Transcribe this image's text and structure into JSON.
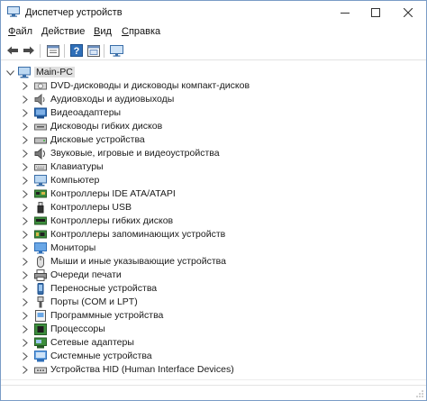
{
  "window": {
    "title": "Диспетчер устройств",
    "controls": [
      "minimize",
      "maximize",
      "close"
    ]
  },
  "menu": [
    {
      "label": "Файл",
      "accel": "Ф",
      "rest": "айл"
    },
    {
      "label": "Действие",
      "accel": "Д",
      "rest": "ействие"
    },
    {
      "label": "Вид",
      "accel": "В",
      "rest": "ид"
    },
    {
      "label": "Справка",
      "accel": "С",
      "rest": "правка"
    }
  ],
  "toolbar": {
    "buttons": [
      "back-icon",
      "forward-icon",
      "properties-icon",
      "help-icon",
      "view-icon",
      "monitor-icon"
    ]
  },
  "tree": {
    "root": {
      "label": "Main-PC",
      "icon": "computer-icon",
      "expanded": true
    },
    "items": [
      {
        "label": "DVD-дисководы и дисководы компакт-дисков",
        "icon": "dvd-drive-icon"
      },
      {
        "label": "Аудиовходы и аудиовыходы",
        "icon": "speaker-icon"
      },
      {
        "label": "Видеоадаптеры",
        "icon": "display-adapter-icon"
      },
      {
        "label": "Дисководы гибких дисков",
        "icon": "floppy-drive-icon"
      },
      {
        "label": "Дисковые устройства",
        "icon": "disk-drive-icon"
      },
      {
        "label": "Звуковые, игровые и видеоустройства",
        "icon": "sound-icon"
      },
      {
        "label": "Клавиатуры",
        "icon": "keyboard-icon"
      },
      {
        "label": "Компьютер",
        "icon": "computer-icon"
      },
      {
        "label": "Контроллеры IDE ATA/ATAPI",
        "icon": "ide-controller-icon"
      },
      {
        "label": "Контроллеры USB",
        "icon": "usb-icon"
      },
      {
        "label": "Контроллеры гибких дисков",
        "icon": "floppy-controller-icon"
      },
      {
        "label": "Контроллеры запоминающих устройств",
        "icon": "storage-controller-icon"
      },
      {
        "label": "Мониторы",
        "icon": "monitor-icon"
      },
      {
        "label": "Мыши и иные указывающие устройства",
        "icon": "mouse-icon"
      },
      {
        "label": "Очереди печати",
        "icon": "printer-icon"
      },
      {
        "label": "Переносные устройства",
        "icon": "portable-device-icon"
      },
      {
        "label": "Порты (COM и LPT)",
        "icon": "port-icon"
      },
      {
        "label": "Программные устройства",
        "icon": "software-device-icon"
      },
      {
        "label": "Процессоры",
        "icon": "processor-icon"
      },
      {
        "label": "Сетевые адаптеры",
        "icon": "network-adapter-icon"
      },
      {
        "label": "Системные устройства",
        "icon": "system-device-icon"
      },
      {
        "label": "Устройства HID (Human Interface Devices)",
        "icon": "hid-icon"
      }
    ]
  },
  "colors": {
    "accent": "#2f6fb8",
    "selection": "#e0e0e0",
    "chevron": "#555555"
  }
}
